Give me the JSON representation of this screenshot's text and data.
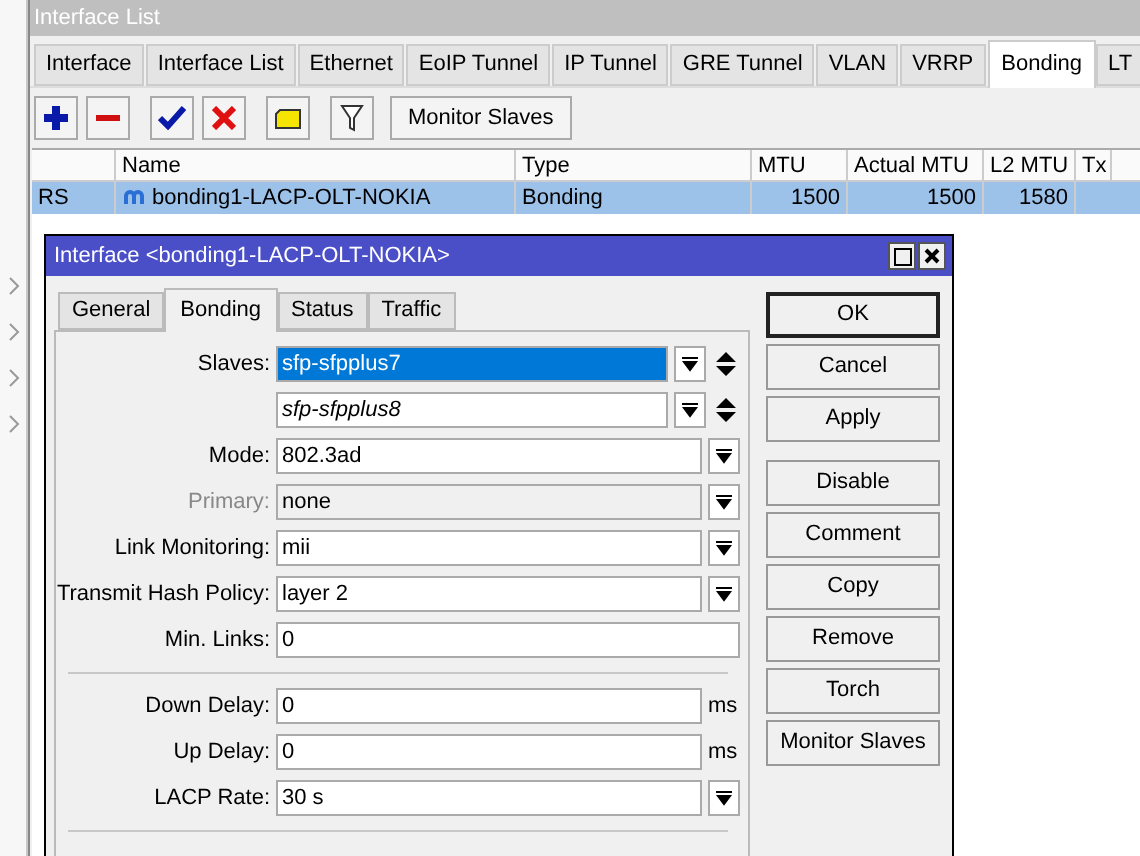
{
  "window": {
    "title": "Interface List"
  },
  "tabs": [
    {
      "label": "Interface",
      "selected": false
    },
    {
      "label": "Interface List",
      "selected": false
    },
    {
      "label": "Ethernet",
      "selected": false
    },
    {
      "label": "EoIP Tunnel",
      "selected": false
    },
    {
      "label": "IP Tunnel",
      "selected": false
    },
    {
      "label": "GRE Tunnel",
      "selected": false
    },
    {
      "label": "VLAN",
      "selected": false
    },
    {
      "label": "VRRP",
      "selected": false
    },
    {
      "label": "Bonding",
      "selected": true
    },
    {
      "label": "LT",
      "selected": false
    }
  ],
  "toolbar": {
    "monitor_button": "Monitor Slaves"
  },
  "table": {
    "columns": [
      "",
      "Name",
      "Type",
      "MTU",
      "Actual MTU",
      "L2 MTU",
      "Tx"
    ],
    "rows": [
      {
        "flags": "RS",
        "name": "bonding1-LACP-OLT-NOKIA",
        "type": "Bonding",
        "mtu": "1500",
        "actual_mtu": "1500",
        "l2_mtu": "1580",
        "selected": true
      }
    ]
  },
  "dialog": {
    "title": "Interface <bonding1-LACP-OLT-NOKIA>",
    "tabs": [
      {
        "label": "General",
        "selected": false
      },
      {
        "label": "Bonding",
        "selected": true
      },
      {
        "label": "Status",
        "selected": false
      },
      {
        "label": "Traffic",
        "selected": false
      }
    ],
    "field_groups": [
      [
        {
          "kind": "slave",
          "label": "Slaves:",
          "value": "sfp-sfpplus7",
          "selected": true,
          "pending": false
        },
        {
          "kind": "slave",
          "value": "sfp-sfpplus8",
          "selected": false,
          "pending": true
        },
        {
          "kind": "dropdown",
          "label": "Mode:",
          "value": "802.3ad",
          "disabled": false
        },
        {
          "kind": "dropdown",
          "label": "Primary:",
          "value": "none",
          "disabled": true
        },
        {
          "kind": "dropdown",
          "label": "Link Monitoring:",
          "value": "mii",
          "disabled": false
        },
        {
          "kind": "dropdown",
          "label": "Transmit Hash Policy:",
          "value": "layer 2",
          "disabled": false
        },
        {
          "kind": "text",
          "label": "Min. Links:",
          "value": "0"
        }
      ],
      [
        {
          "kind": "unit",
          "label": "Down Delay:",
          "value": "0",
          "unit": "ms"
        },
        {
          "kind": "unit",
          "label": "Up Delay:",
          "value": "0",
          "unit": "ms"
        },
        {
          "kind": "dropdown",
          "label": "LACP Rate:",
          "value": "30 s",
          "disabled": false
        }
      ]
    ],
    "buttons": [
      {
        "label": "OK",
        "default": true
      },
      {
        "label": "Cancel",
        "default": false
      },
      {
        "label": "Apply",
        "default": false
      },
      {
        "label": "Disable",
        "default": false
      },
      {
        "label": "Comment",
        "default": false
      },
      {
        "label": "Copy",
        "default": false
      },
      {
        "label": "Remove",
        "default": false
      },
      {
        "label": "Torch",
        "default": false
      },
      {
        "label": "Monitor Slaves",
        "default": false
      }
    ]
  }
}
